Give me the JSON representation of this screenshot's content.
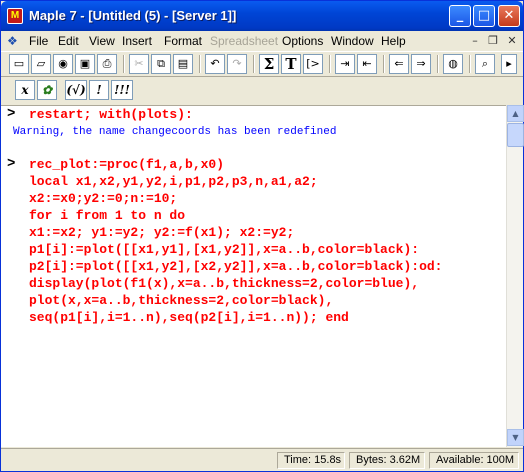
{
  "window": {
    "title": "Maple 7 - [Untitled (5) - [Server 1]]",
    "app_icon_glyph": "M"
  },
  "menu": {
    "items": [
      "File",
      "Edit",
      "View",
      "Insert",
      "Format",
      "Spreadsheet",
      "Options",
      "Window",
      "Help"
    ],
    "disabled": [
      "Spreadsheet"
    ]
  },
  "toolbar": {
    "sigma": "Σ",
    "text_T": "T",
    "prompt": "[>"
  },
  "toolbar2": {
    "buttons": [
      "x",
      "✿",
      "(√)",
      "!",
      "!!!"
    ]
  },
  "worksheet": {
    "prompt_glyph": ">",
    "input1": "restart; with(plots):",
    "warning": "Warning, the name changecoords has been redefined",
    "input2_lines": [
      "rec_plot:=proc(f1,a,b,x0)",
      "local x1,x2,y1,y2,i,p1,p2,p3,n,a1,a2;",
      "x2:=x0;y2:=0;n:=10;",
      "for i from 1 to n do",
      "x1:=x2; y1:=y2; y2:=f(x1); x2:=y2;",
      "p1[i]:=plot([[x1,y1],[x1,y2]],x=a..b,color=black):",
      "p2[i]:=plot([[x1,y2],[x2,y2]],x=a..b,color=black):od:",
      "display(plot(f1(x),x=a..b,thickness=2,color=blue),",
      "plot(x,x=a..b,thickness=2,color=black),",
      "seq(p1[i],i=1..n),seq(p2[i],i=1..n)); end"
    ],
    "code_color": "#ff0000",
    "warning_color": "#0000ff"
  },
  "status": {
    "time": "Time: 15.8s",
    "bytes": "Bytes: 3.62M",
    "available": "Available: 100M"
  }
}
